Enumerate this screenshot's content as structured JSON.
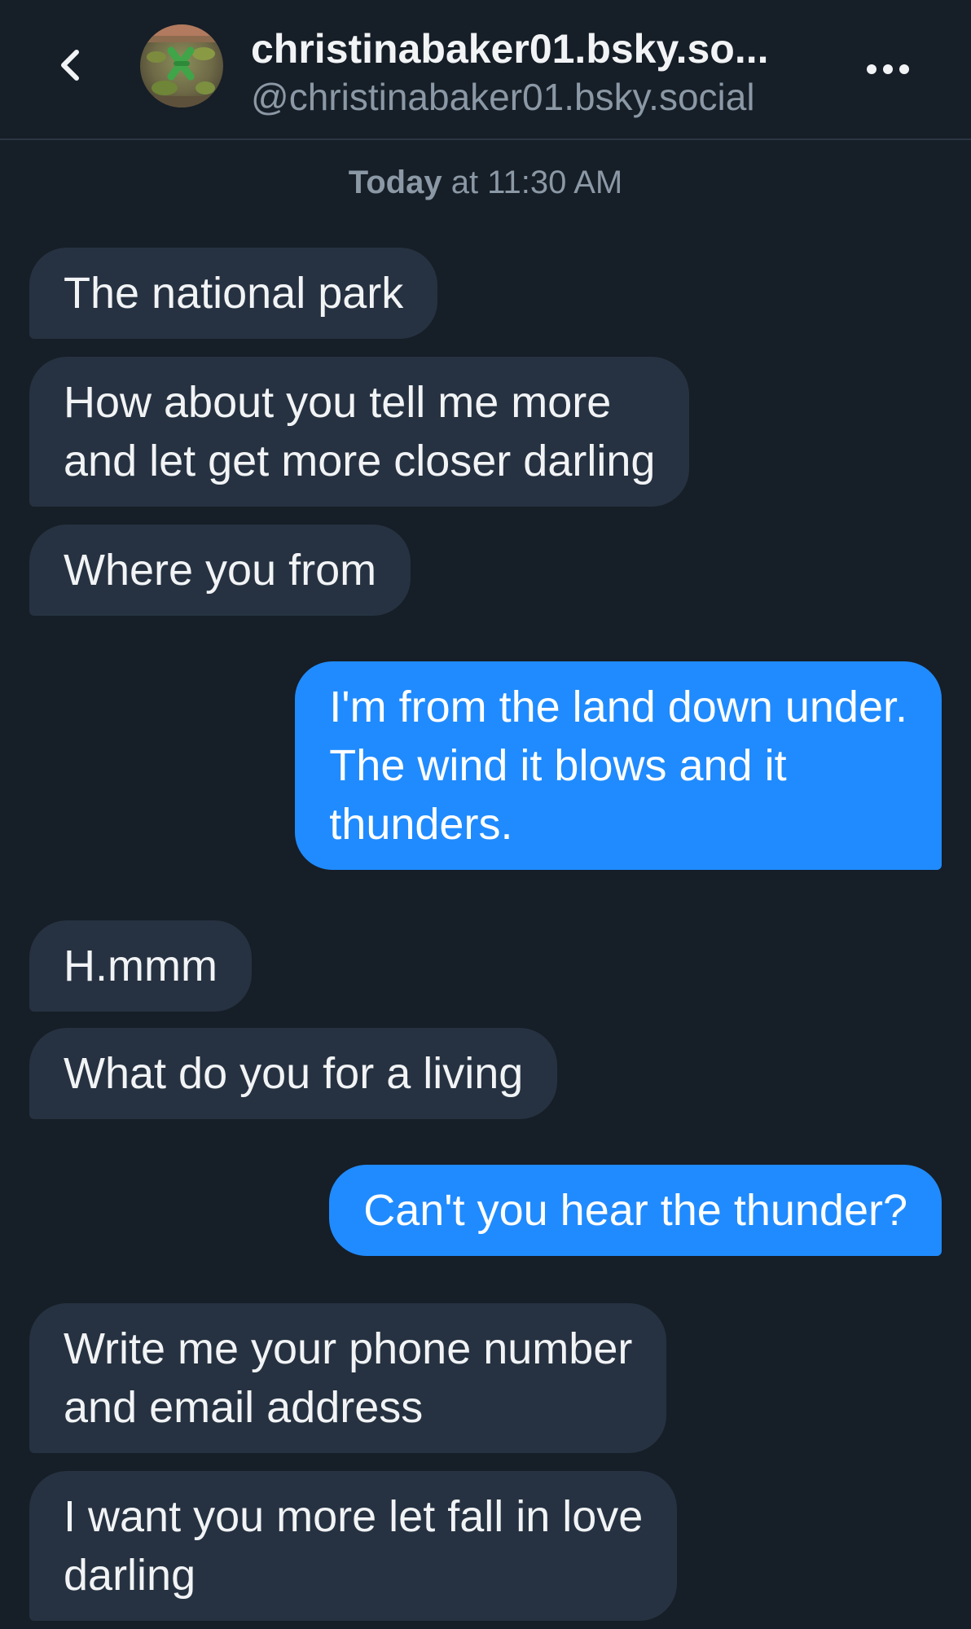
{
  "header": {
    "title": "christinabaker01.bsky.so...",
    "handle": "@christinabaker01.bsky.social",
    "back_icon": "chevron-left-icon",
    "more_icon": "ellipsis-icon"
  },
  "timestamp": {
    "day": "Today",
    "rest": " at 11:30 AM"
  },
  "messages": [
    {
      "sender": "them",
      "text": "The national park"
    },
    {
      "sender": "them",
      "text": "How about you tell me more\nand let get more closer darling"
    },
    {
      "sender": "them",
      "text": "Where you from"
    },
    {
      "sender": "me",
      "text": "I'm from the land down under.\nThe wind it blows and it\nthunders."
    },
    {
      "sender": "them",
      "text": "H.mmm"
    },
    {
      "sender": "them",
      "text": "What do you for a living"
    },
    {
      "sender": "me",
      "text": "Can't you hear the thunder?"
    },
    {
      "sender": "them",
      "text": "Write me your phone number\nand email address"
    },
    {
      "sender": "them",
      "text": "I want you more let fall in love\ndarling"
    }
  ],
  "colors": {
    "background": "#161e27",
    "incoming_bubble": "#263241",
    "outgoing_bubble": "#208bfe",
    "secondary_text": "#8b98a5"
  }
}
